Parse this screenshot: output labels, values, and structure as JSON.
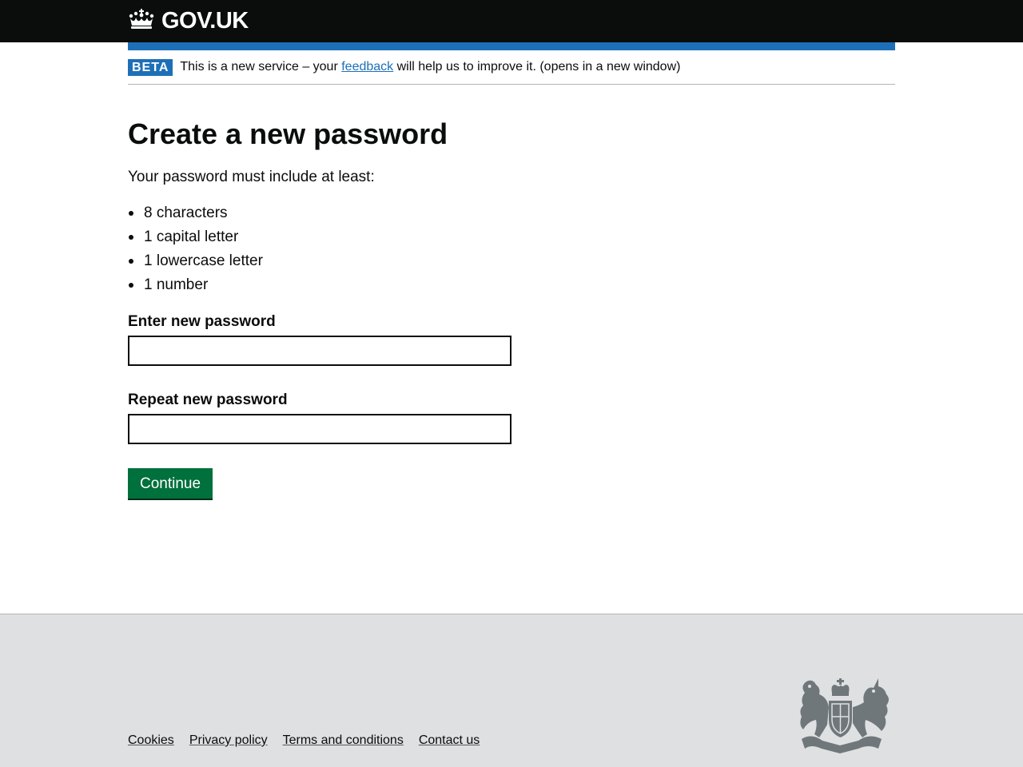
{
  "header": {
    "logo_text": "GOV.UK"
  },
  "phase_banner": {
    "tag": "BETA",
    "text_before": "This is a new service – your ",
    "link_text": "feedback",
    "text_after": " will help us to improve it. (opens in a new window)"
  },
  "main": {
    "title": "Create a new password",
    "intro": "Your password must include at least:",
    "requirements": [
      "8 characters",
      "1 capital letter",
      "1 lowercase letter",
      "1 number"
    ],
    "new_password_label": "Enter new password",
    "new_password_value": "",
    "repeat_password_label": "Repeat new password",
    "repeat_password_value": "",
    "continue_label": "Continue"
  },
  "footer": {
    "links": [
      "Cookies",
      "Privacy policy",
      "Terms and conditions",
      "Contact us"
    ]
  },
  "colors": {
    "header_bg": "#0b0c0c",
    "brand_blue": "#1d70b8",
    "button_green": "#00703c",
    "footer_bg": "#dfe0e1"
  },
  "icons": {
    "logo": "crown-icon",
    "footer": "royal-coat-of-arms-icon"
  }
}
